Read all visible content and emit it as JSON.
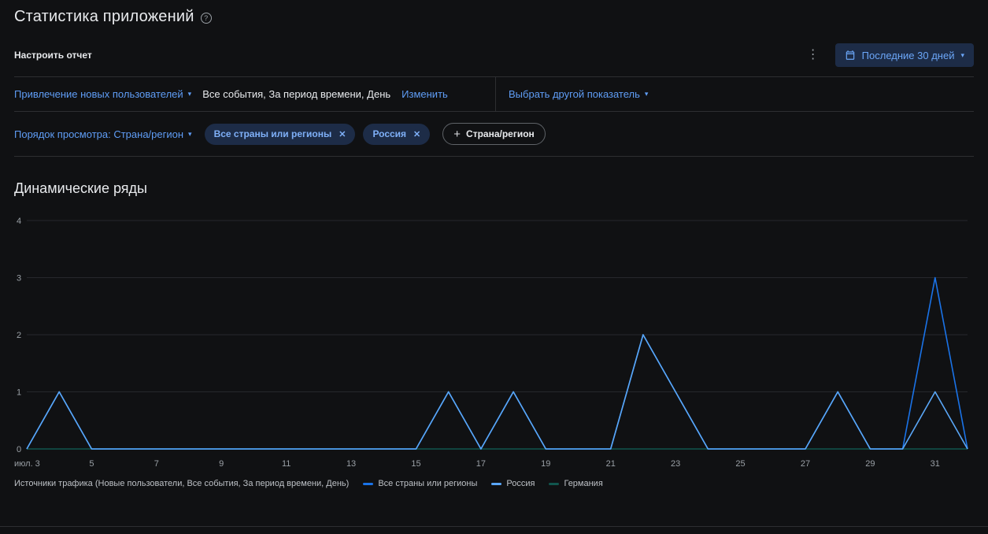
{
  "page": {
    "title": "Статистика приложений"
  },
  "toolbar": {
    "configure_label": "Настроить отчет",
    "date_range_label": "Последние 30 дней"
  },
  "filters": {
    "metric_selector_label": "Привлечение новых пользователей",
    "metric_detail": "Все события, За период времени, День",
    "edit_link": "Изменить",
    "other_metric_label": "Выбрать другой показатель"
  },
  "dimension_bar": {
    "order_selector_label": "Порядок просмотра: Страна/регион",
    "chips": [
      {
        "label": "Все страны или регионы"
      },
      {
        "label": "Россия"
      }
    ],
    "add_chip_label": "Страна/регион"
  },
  "chart_section": {
    "title": "Динамические ряды",
    "footnote": "Источники трафика (Новые пользователи, Все события, За период времени, День)"
  },
  "colors": {
    "accent_blue": "#5f9df6",
    "chip_bg": "#1d2c47",
    "grid": "#26282c",
    "background": "#101113"
  },
  "chart_data": {
    "type": "line",
    "title": "Динамические ряды",
    "x": [
      3,
      4,
      5,
      6,
      7,
      8,
      9,
      10,
      11,
      12,
      13,
      14,
      15,
      16,
      17,
      18,
      19,
      20,
      21,
      22,
      23,
      24,
      25,
      26,
      27,
      28,
      29,
      30,
      31,
      32
    ],
    "x_ticks": [
      {
        "value": 3,
        "label": "июл. 3"
      },
      {
        "value": 5,
        "label": "5"
      },
      {
        "value": 7,
        "label": "7"
      },
      {
        "value": 9,
        "label": "9"
      },
      {
        "value": 11,
        "label": "11"
      },
      {
        "value": 13,
        "label": "13"
      },
      {
        "value": 15,
        "label": "15"
      },
      {
        "value": 17,
        "label": "17"
      },
      {
        "value": 19,
        "label": "19"
      },
      {
        "value": 21,
        "label": "21"
      },
      {
        "value": 23,
        "label": "23"
      },
      {
        "value": 25,
        "label": "25"
      },
      {
        "value": 27,
        "label": "27"
      },
      {
        "value": 29,
        "label": "29"
      },
      {
        "value": 31,
        "label": "31"
      }
    ],
    "ylim": [
      0,
      4
    ],
    "yticks": [
      0,
      1,
      2,
      3,
      4
    ],
    "grid": true,
    "legend_position": "bottom",
    "series": [
      {
        "name": "Все страны или регионы",
        "color": "#1a73e8",
        "z": 1,
        "values": [
          0,
          1,
          0,
          0,
          0,
          0,
          0,
          0,
          0,
          0,
          0,
          0,
          0,
          1,
          0,
          1,
          0,
          0,
          0,
          2,
          1,
          0,
          0,
          0,
          0,
          1,
          0,
          0,
          3,
          0
        ]
      },
      {
        "name": "Россия",
        "color": "#5aa7f7",
        "z": 2,
        "values": [
          0,
          1,
          0,
          0,
          0,
          0,
          0,
          0,
          0,
          0,
          0,
          0,
          0,
          1,
          0,
          1,
          0,
          0,
          0,
          2,
          1,
          0,
          0,
          0,
          0,
          1,
          0,
          0,
          1,
          0
        ]
      },
      {
        "name": "Германия",
        "color": "#11564e",
        "z": 0,
        "values": [
          0,
          0,
          0,
          0,
          0,
          0,
          0,
          0,
          0,
          0,
          0,
          0,
          0,
          0,
          0,
          0,
          0,
          0,
          0,
          0,
          0,
          0,
          0,
          0,
          0,
          0,
          0,
          0,
          0,
          0
        ]
      }
    ]
  }
}
